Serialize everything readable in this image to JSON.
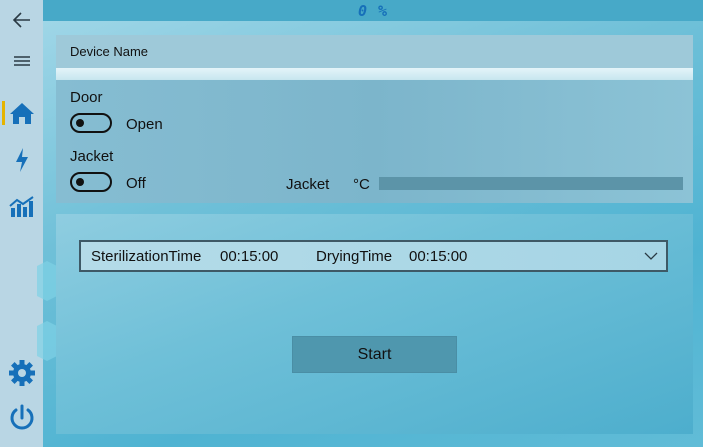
{
  "header": {
    "progress": "0 %"
  },
  "sidebar": {
    "items": [
      {
        "icon": "back-arrow-icon"
      },
      {
        "icon": "hamburger-menu-icon"
      },
      {
        "icon": "home-icon",
        "active": true
      },
      {
        "icon": "lightning-icon"
      },
      {
        "icon": "chart-icon"
      },
      {
        "icon": "gear-icon"
      },
      {
        "icon": "power-icon"
      }
    ],
    "active_color": "#e5b400",
    "icon_color": "#1670b9"
  },
  "device": {
    "name_label": "Device Name"
  },
  "status": {
    "door": {
      "label": "Door",
      "state": "Open"
    },
    "jacket": {
      "label": "Jacket",
      "state": "Off"
    },
    "jacket_temp": {
      "label": "Jacket",
      "unit": "°C"
    }
  },
  "cycle": {
    "sterilization_label": "SterilizationTime",
    "sterilization_value": "00:15:00",
    "drying_label": "DryingTime",
    "drying_value": "00:15:00"
  },
  "actions": {
    "start_label": "Start"
  }
}
